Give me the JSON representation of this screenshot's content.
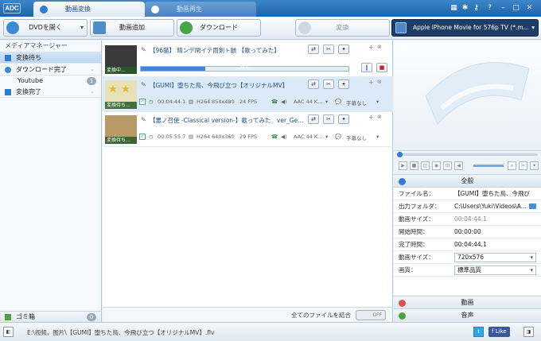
{
  "app": {
    "logo": "ADC"
  },
  "tabs": [
    {
      "label": "動画変換",
      "active": true
    },
    {
      "label": "動画再生",
      "active": false
    }
  ],
  "toolbar": {
    "open_dvd": "DVDを開く",
    "add_video": "動画追加",
    "download": "ダウンロード",
    "convert": "変換",
    "device": "Apple iPhone Movie for 576p TV (*.m..."
  },
  "sidebar": {
    "header": "メディアマネージャー",
    "items": [
      {
        "label": "変換待ち",
        "selected": true
      },
      {
        "label": "ダウンロード完了"
      },
      {
        "label": "Youtube",
        "badge": "1"
      },
      {
        "label": "変換完了"
      }
    ],
    "trash": {
      "label": "ゴミ箱",
      "badge": "0"
    }
  },
  "files": [
    {
      "title": "【96猫】 晴ンデ閑イテ雨剣ト骸 【歌ってみた】",
      "thumb_label": "変換中...",
      "progress_text": "31%",
      "progress": 0.31
    },
    {
      "title": "【GUMI】堕ちた鳥、今飛び立つ【オリジナルMV】",
      "thumb_label": "変換待ち...",
      "duration": "00:04:44.1",
      "codec": "H264",
      "resolution": "854x480",
      "fps": "24 FPS",
      "audio": "AAC 44 K...",
      "subtitle": "字幕なし",
      "selected": true
    },
    {
      "title": "【悪ノ召使 -Classical version-】歌ってみた　ver_Ge...",
      "thumb_label": "変換待ち...",
      "duration": "00:05:55.7",
      "codec": "H264",
      "resolution": "640x360",
      "fps": "29 FPS",
      "audio": "AAC 44 K...",
      "subtitle": "字幕なし"
    }
  ],
  "merge": {
    "label": "全てのファイルを結合",
    "toggle": "OFF"
  },
  "props": {
    "header": "全般",
    "rows": [
      {
        "key": "ファイル名：",
        "value": "【GUMI】堕ちた鳥、今飛び"
      },
      {
        "key": "出力フォルダ：",
        "value": "C:\\Users\\Yuki\\Videos\\A..."
      },
      {
        "key": "動画サイズ：",
        "value": "00:04:44.1"
      },
      {
        "key": "開始時間：",
        "value": "00:00:00"
      },
      {
        "key": "完了時間：",
        "value": "00:04:44.1"
      },
      {
        "key": "動画サイズ：",
        "value": "720x576"
      },
      {
        "key": "画質：",
        "value": "標準品質"
      }
    ],
    "video_section": "動画",
    "audio_section": "音声"
  },
  "status": {
    "path": "E:\\视频，图片\\【GUMI】堕ちた鳥、今飛び立つ【オリジナルMV】.flv",
    "like": "Like"
  },
  "colors": {
    "accent": "#2f7cd3",
    "titlebar": "#1f62a8",
    "device_bg": "#1f3d66"
  }
}
